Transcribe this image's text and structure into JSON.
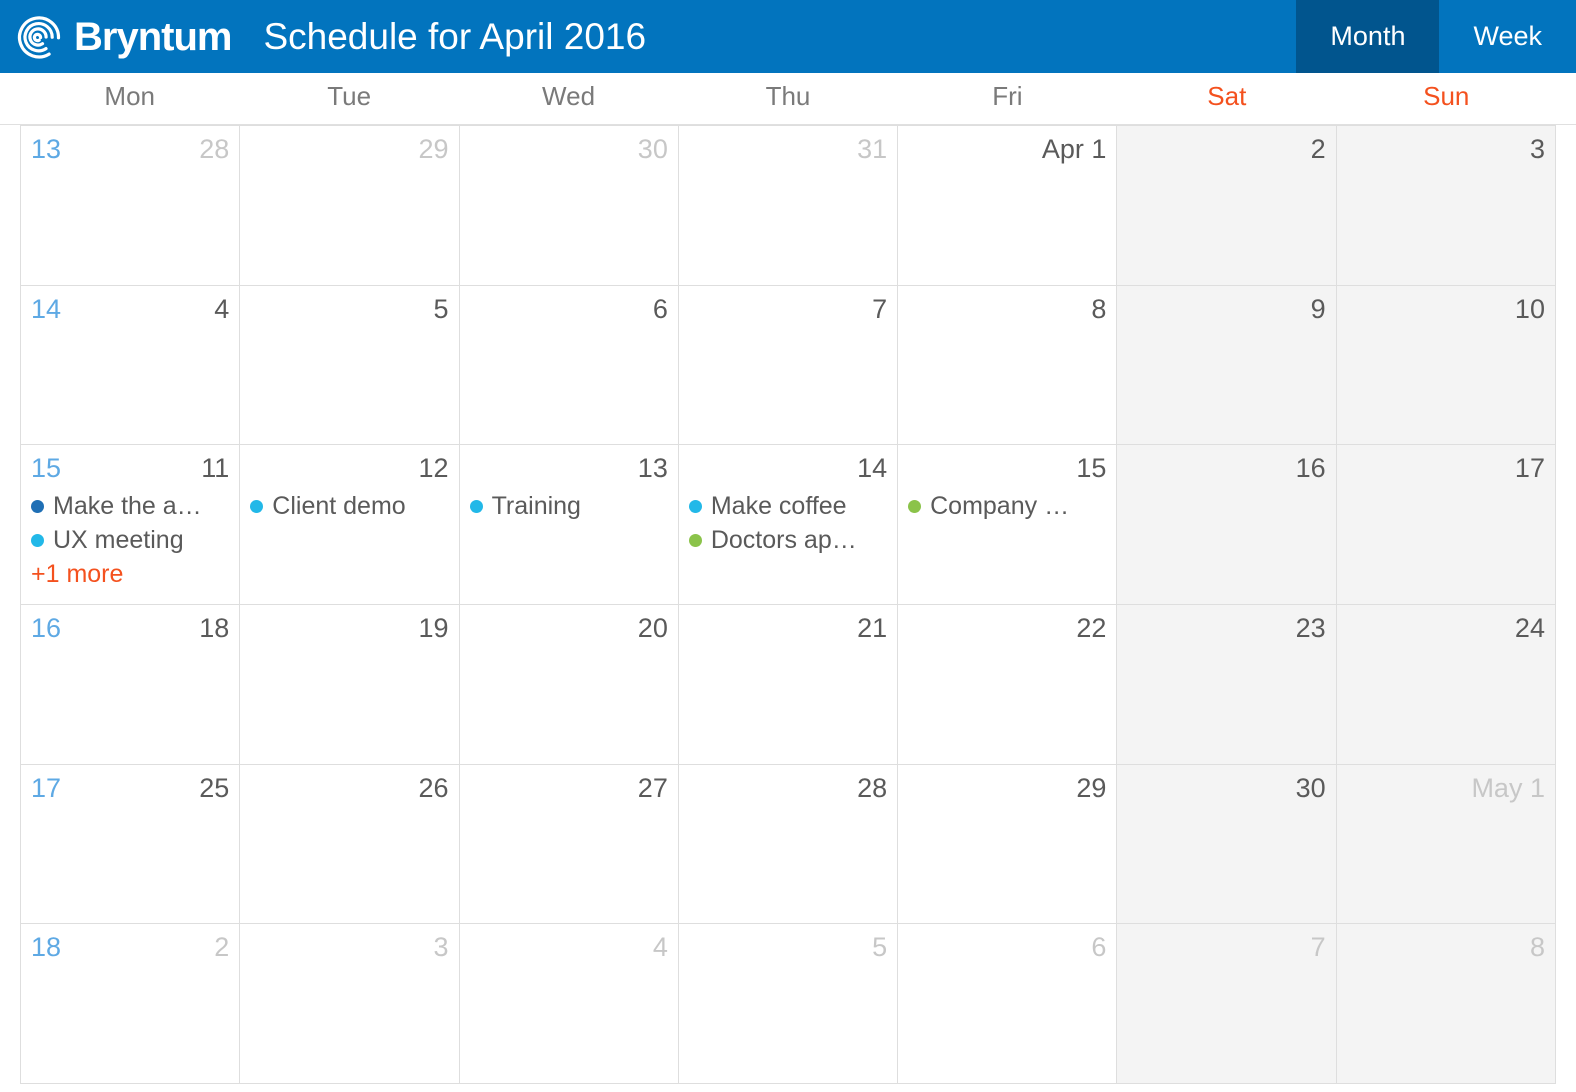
{
  "header": {
    "brand_name": "Bryntum",
    "logo_icon": "spiral-logo-icon",
    "title": "Schedule for April 2016",
    "brand_blue": "#0274be",
    "active_blue": "#01558e",
    "views": [
      {
        "label": "Month",
        "active": true
      },
      {
        "label": "Week",
        "active": false
      }
    ]
  },
  "weekdays": [
    {
      "label": "Mon",
      "weekend": false
    },
    {
      "label": "Tue",
      "weekend": false
    },
    {
      "label": "Wed",
      "weekend": false
    },
    {
      "label": "Thu",
      "weekend": false
    },
    {
      "label": "Fri",
      "weekend": false
    },
    {
      "label": "Sat",
      "weekend": true
    },
    {
      "label": "Sun",
      "weekend": true
    }
  ],
  "colors": {
    "weekend_text": "#f4511e",
    "week_number": "#5ea9e4",
    "day_text": "#5a5a5a",
    "other_month_text": "#c7c7c7",
    "weekend_cell_bg": "#f4f4f4",
    "more_link": "#f4511e",
    "event_navy": "#1f6fb5",
    "event_cyan": "#22b8e8",
    "event_green": "#8bc34a"
  },
  "weeks": [
    {
      "week_number": "13",
      "days": [
        {
          "day": "28",
          "other_month": true,
          "weekend": false,
          "events": []
        },
        {
          "day": "29",
          "other_month": true,
          "weekend": false,
          "events": []
        },
        {
          "day": "30",
          "other_month": true,
          "weekend": false,
          "events": []
        },
        {
          "day": "31",
          "other_month": true,
          "weekend": false,
          "events": []
        },
        {
          "day": "Apr 1",
          "other_month": false,
          "weekend": false,
          "events": []
        },
        {
          "day": "2",
          "other_month": false,
          "weekend": true,
          "events": []
        },
        {
          "day": "3",
          "other_month": false,
          "weekend": true,
          "events": []
        }
      ]
    },
    {
      "week_number": "14",
      "days": [
        {
          "day": "4",
          "other_month": false,
          "weekend": false,
          "events": []
        },
        {
          "day": "5",
          "other_month": false,
          "weekend": false,
          "events": []
        },
        {
          "day": "6",
          "other_month": false,
          "weekend": false,
          "events": []
        },
        {
          "day": "7",
          "other_month": false,
          "weekend": false,
          "events": []
        },
        {
          "day": "8",
          "other_month": false,
          "weekend": false,
          "events": []
        },
        {
          "day": "9",
          "other_month": false,
          "weekend": true,
          "events": []
        },
        {
          "day": "10",
          "other_month": false,
          "weekend": true,
          "events": []
        }
      ]
    },
    {
      "week_number": "15",
      "days": [
        {
          "day": "11",
          "other_month": false,
          "weekend": false,
          "events": [
            {
              "name": "Make the a…",
              "color": "#1f6fb5"
            },
            {
              "name": "UX meeting",
              "color": "#22b8e8"
            }
          ],
          "more_label": "+1 more"
        },
        {
          "day": "12",
          "other_month": false,
          "weekend": false,
          "events": [
            {
              "name": "Client demo",
              "color": "#22b8e8"
            }
          ]
        },
        {
          "day": "13",
          "other_month": false,
          "weekend": false,
          "events": [
            {
              "name": "Training",
              "color": "#22b8e8"
            }
          ]
        },
        {
          "day": "14",
          "other_month": false,
          "weekend": false,
          "events": [
            {
              "name": "Make coffee",
              "color": "#22b8e8"
            },
            {
              "name": "Doctors ap…",
              "color": "#8bc34a"
            }
          ]
        },
        {
          "day": "15",
          "other_month": false,
          "weekend": false,
          "events": [
            {
              "name": "Company …",
              "color": "#8bc34a"
            }
          ]
        },
        {
          "day": "16",
          "other_month": false,
          "weekend": true,
          "events": []
        },
        {
          "day": "17",
          "other_month": false,
          "weekend": true,
          "events": []
        }
      ]
    },
    {
      "week_number": "16",
      "days": [
        {
          "day": "18",
          "other_month": false,
          "weekend": false,
          "events": []
        },
        {
          "day": "19",
          "other_month": false,
          "weekend": false,
          "events": []
        },
        {
          "day": "20",
          "other_month": false,
          "weekend": false,
          "events": []
        },
        {
          "day": "21",
          "other_month": false,
          "weekend": false,
          "events": []
        },
        {
          "day": "22",
          "other_month": false,
          "weekend": false,
          "events": []
        },
        {
          "day": "23",
          "other_month": false,
          "weekend": true,
          "events": []
        },
        {
          "day": "24",
          "other_month": false,
          "weekend": true,
          "events": []
        }
      ]
    },
    {
      "week_number": "17",
      "days": [
        {
          "day": "25",
          "other_month": false,
          "weekend": false,
          "events": []
        },
        {
          "day": "26",
          "other_month": false,
          "weekend": false,
          "events": []
        },
        {
          "day": "27",
          "other_month": false,
          "weekend": false,
          "events": []
        },
        {
          "day": "28",
          "other_month": false,
          "weekend": false,
          "events": []
        },
        {
          "day": "29",
          "other_month": false,
          "weekend": false,
          "events": []
        },
        {
          "day": "30",
          "other_month": false,
          "weekend": true,
          "events": []
        },
        {
          "day": "May 1",
          "other_month": true,
          "weekend": true,
          "events": []
        }
      ]
    },
    {
      "week_number": "18",
      "days": [
        {
          "day": "2",
          "other_month": true,
          "weekend": false,
          "events": []
        },
        {
          "day": "3",
          "other_month": true,
          "weekend": false,
          "events": []
        },
        {
          "day": "4",
          "other_month": true,
          "weekend": false,
          "events": []
        },
        {
          "day": "5",
          "other_month": true,
          "weekend": false,
          "events": []
        },
        {
          "day": "6",
          "other_month": true,
          "weekend": false,
          "events": []
        },
        {
          "day": "7",
          "other_month": true,
          "weekend": true,
          "events": []
        },
        {
          "day": "8",
          "other_month": true,
          "weekend": true,
          "events": []
        }
      ]
    }
  ]
}
